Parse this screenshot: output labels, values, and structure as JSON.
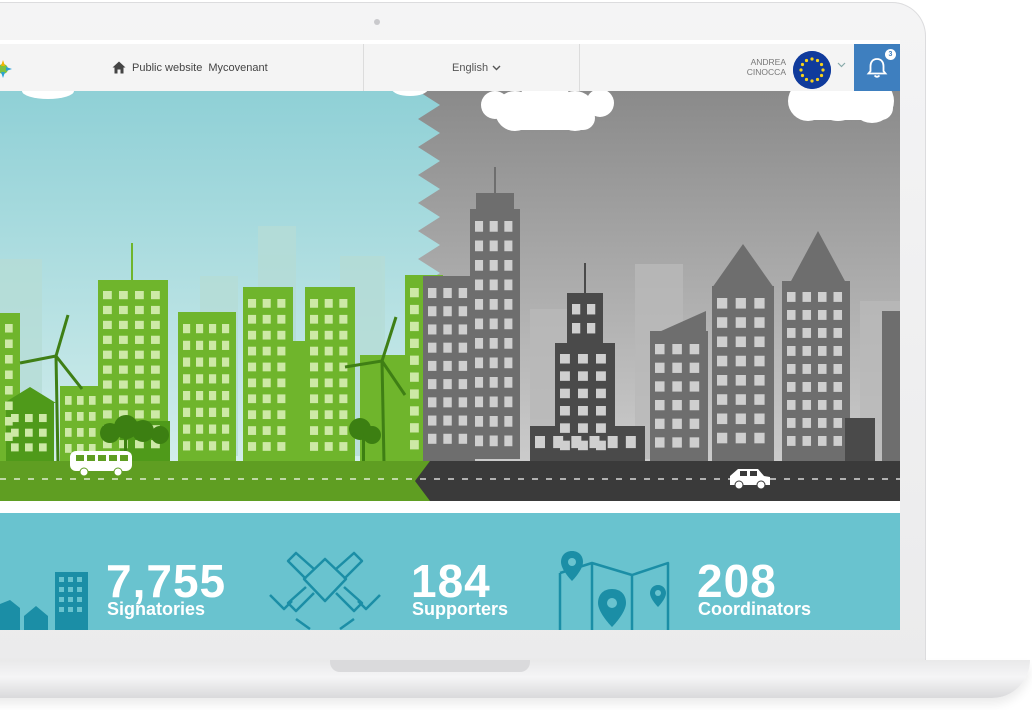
{
  "header": {
    "home_icon": "home-icon",
    "public_website": "Public website",
    "mycovenant": "Mycovenant",
    "language": "English",
    "user_first": "ANDREA",
    "user_last": "CINOCCA",
    "notifications_count": "3",
    "bell_icon": "bell-icon"
  },
  "stats": [
    {
      "value": "7,755",
      "label": "Signatories",
      "icon": "city-icon"
    },
    {
      "value": "184",
      "label": "Supporters",
      "icon": "joined-hands-icon"
    },
    {
      "value": "208",
      "label": "Coordinators",
      "icon": "map-pin-icon"
    }
  ],
  "colors": {
    "header_bg": "#f4f4f4",
    "bell_bg": "#3e7fbf",
    "stats_bg": "#69c3cf",
    "green_city": "#6fb52c",
    "grey_city": "#6b6b6b"
  }
}
